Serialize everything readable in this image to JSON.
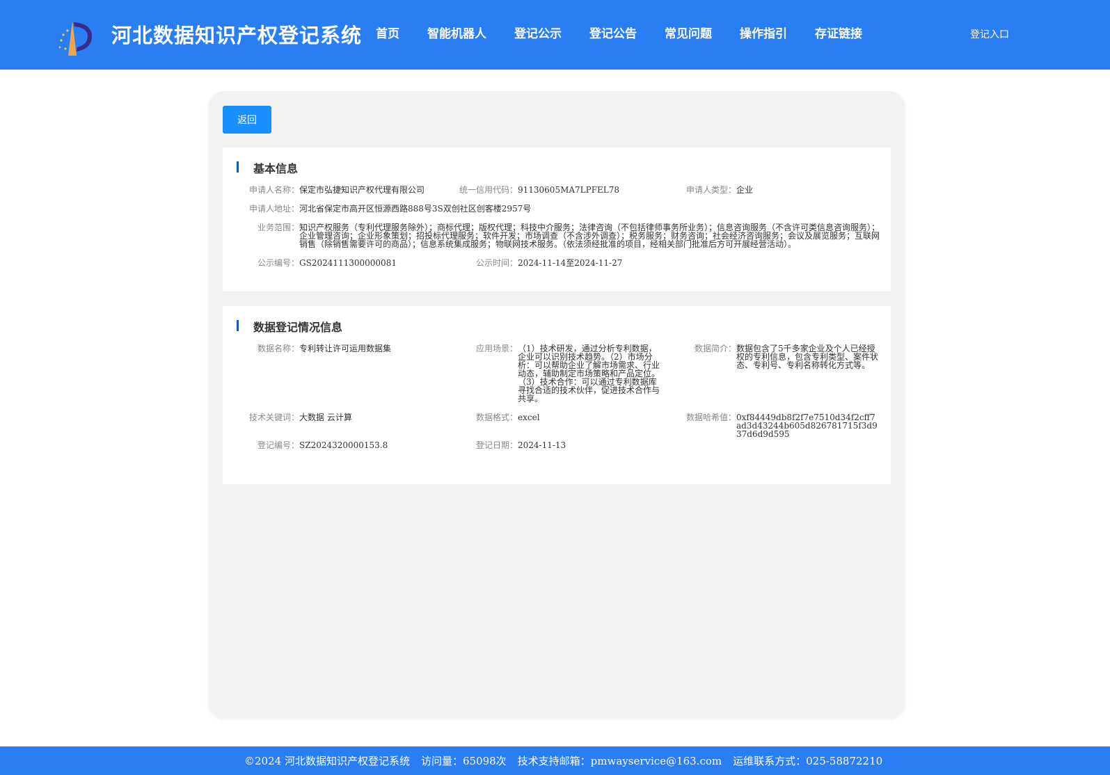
{
  "header": {
    "site_title": "河北数据知识产权登记系统",
    "nav": [
      "首页",
      "智能机器人",
      "登记公示",
      "登记公告",
      "常见问题",
      "操作指引",
      "存证链接"
    ],
    "login": "登记入口"
  },
  "back_button": "返回",
  "basic": {
    "title": "基本信息",
    "applicant_name": {
      "label": "申请人名称：",
      "value": "保定市弘捷知识产权代理有限公司"
    },
    "credit_code": {
      "label": "统一信用代码：",
      "value": "91130605MA7LPFEL78"
    },
    "applicant_type": {
      "label": "申请人类型：",
      "value": "企业"
    },
    "address": {
      "label": "申请人地址：",
      "value": "河北省保定市高开区恒源西路888号3S双创社区创客楼2957号"
    },
    "business_scope": {
      "label": "业务范围：",
      "value": "知识产权服务（专利代理服务除外）；商标代理；版权代理；科技中介服务；法律咨询（不包括律师事务所业务）；信息咨询服务（不含许可类信息咨询服务）；企业管理咨询；企业形象策划；招投标代理服务；软件开发；市场调查（不含涉外调查）；税务服务；财务咨询；社会经济咨询服务；会议及展览服务；互联网销售（除销售需要许可的商品）；信息系统集成服务；物联网技术服务。（依法须经批准的项目，经相关部门批准后方可开展经营活动）。"
    },
    "notice_no": {
      "label": "公示编号：",
      "value": "GS2024111300000081"
    },
    "notice_time": {
      "label": "公示时间：",
      "value": "2024-11-14至2024-11-27"
    }
  },
  "data_reg": {
    "title": "数据登记情况信息",
    "data_name": {
      "label": "数据名称：",
      "value": "专利转让许可运用数据集"
    },
    "scenario": {
      "label": "应用场景：",
      "value": "（1）技术研发，通过分析专利数据，企业可以识别技术趋势。（2）市场分析：可以帮助企业了解市场需求、行业动态，辅助制定市场策略和产品定位。（3）技术合作：可以通过专利数据库寻找合适的技术伙伴，促进技术合作与共享。"
    },
    "summary": {
      "label": "数据简介：",
      "value": "数据包含了5千多家企业及个人已经授权的专利信息，包含专利类型、案件状态、专利号、专利名称转化方式等。"
    },
    "keywords": {
      "label": "技术关键词：",
      "value": "大数据 云计算"
    },
    "format": {
      "label": "数据格式：",
      "value": "excel"
    },
    "hash": {
      "label": "数据哈希值：",
      "value": "0xf84449db8f2f7e7510d34f2cff7ad3d43244b605d826781715f3d937d6d9d595"
    },
    "reg_no": {
      "label": "登记编号：",
      "value": "SZ2024320000153.8"
    },
    "reg_date": {
      "label": "登记日期：",
      "value": "2024-11-13"
    }
  },
  "footer": {
    "copyright": "©2024 河北数据知识产权登记系统",
    "visits": "访问量：65098次",
    "email": "技术支持邮箱：pmwayservice@163.com",
    "phone": "运维联系方式：025-58872210"
  }
}
